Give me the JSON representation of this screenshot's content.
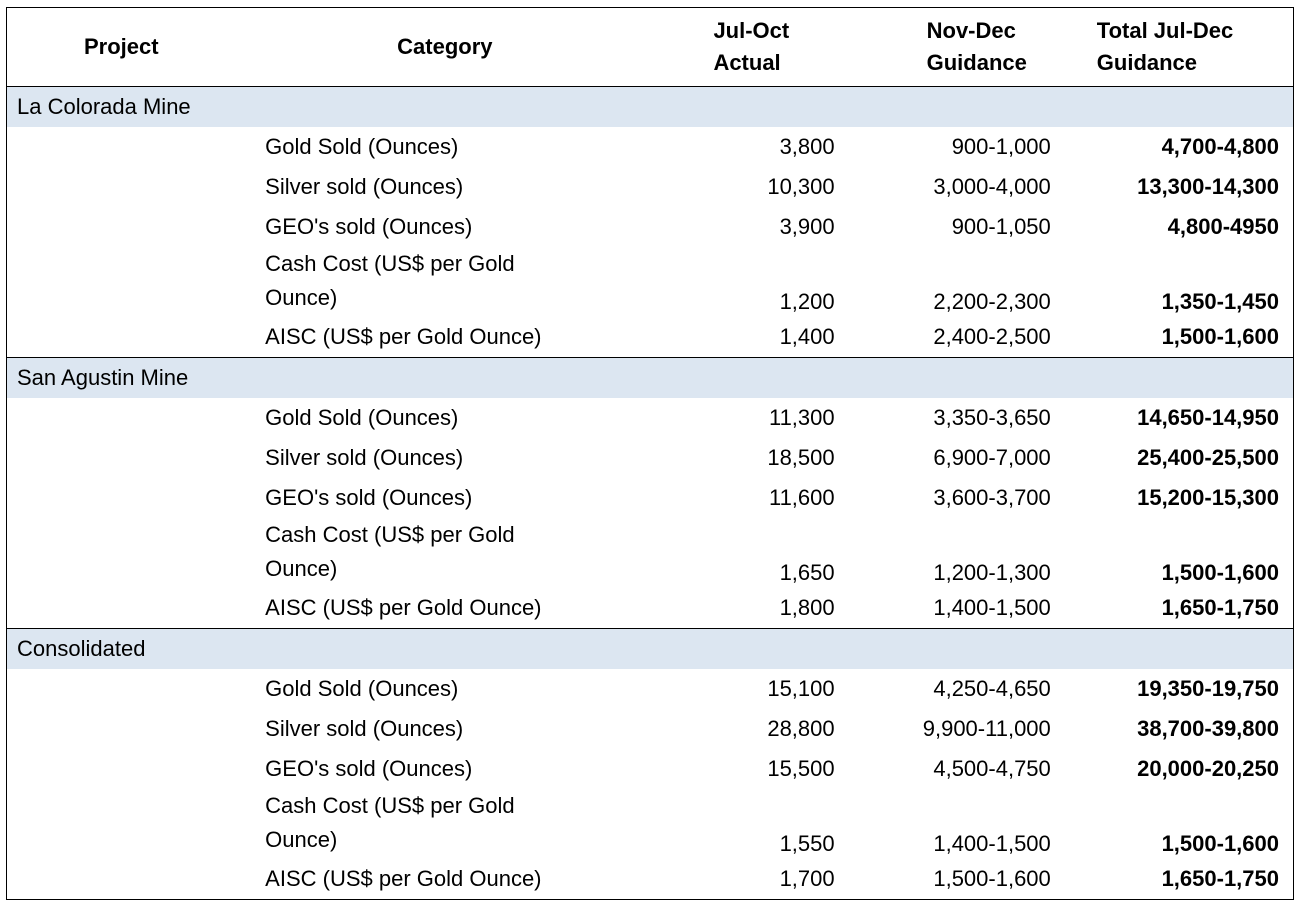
{
  "headers": {
    "project": "Project",
    "category": "Category",
    "jul_oct": [
      "Jul-Oct",
      "Actual"
    ],
    "nov_dec": [
      "Nov-Dec",
      "Guidance"
    ],
    "total": [
      "Total Jul-Dec",
      "Guidance"
    ]
  },
  "sections": [
    {
      "name": "La Colorada Mine",
      "rows": [
        {
          "category": "Gold Sold (Ounces)",
          "jul_oct": "3,800",
          "nov_dec": "900-1,000",
          "total": "4,700-4,800"
        },
        {
          "category": "Silver sold (Ounces)",
          "jul_oct": "10,300",
          "nov_dec": "3,000-4,000",
          "total": "13,300-14,300"
        },
        {
          "category": "GEO's sold (Ounces)",
          "jul_oct": "3,900",
          "nov_dec": "900-1,050",
          "total": "4,800-4950"
        },
        {
          "category": "Cash Cost (US$ per Gold\nOunce)",
          "jul_oct": "1,200",
          "nov_dec": "2,200-2,300",
          "total": "1,350-1,450"
        },
        {
          "category": "AISC (US$ per Gold Ounce)",
          "jul_oct": "1,400",
          "nov_dec": "2,400-2,500",
          "total": "1,500-1,600"
        }
      ]
    },
    {
      "name": "San Agustin Mine",
      "rows": [
        {
          "category": "Gold Sold (Ounces)",
          "jul_oct": "11,300",
          "nov_dec": "3,350-3,650",
          "total": "14,650-14,950"
        },
        {
          "category": "Silver sold (Ounces)",
          "jul_oct": "18,500",
          "nov_dec": "6,900-7,000",
          "total": "25,400-25,500"
        },
        {
          "category": "GEO's sold (Ounces)",
          "jul_oct": "11,600",
          "nov_dec": "3,600-3,700",
          "total": "15,200-15,300"
        },
        {
          "category": "Cash Cost (US$ per Gold\nOunce)",
          "jul_oct": "1,650",
          "nov_dec": "1,200-1,300",
          "total": "1,500-1,600"
        },
        {
          "category": "AISC (US$ per Gold Ounce)",
          "jul_oct": "1,800",
          "nov_dec": "1,400-1,500",
          "total": "1,650-1,750"
        }
      ]
    },
    {
      "name": "Consolidated",
      "rows": [
        {
          "category": "Gold Sold (Ounces)",
          "jul_oct": "15,100",
          "nov_dec": "4,250-4,650",
          "total": "19,350-19,750"
        },
        {
          "category": "Silver sold (Ounces)",
          "jul_oct": "28,800",
          "nov_dec": "9,900-11,000",
          "total": "38,700-39,800"
        },
        {
          "category": "GEO's sold (Ounces)",
          "jul_oct": "15,500",
          "nov_dec": "4,500-4,750",
          "total": "20,000-20,250"
        },
        {
          "category": "Cash Cost (US$ per Gold\nOunce)",
          "jul_oct": "1,550",
          "nov_dec": "1,400-1,500",
          "total": "1,500-1,600"
        },
        {
          "category": "AISC (US$ per Gold Ounce)",
          "jul_oct": "1,700",
          "nov_dec": "1,500-1,600",
          "total": "1,650-1,750"
        }
      ]
    }
  ],
  "colors": {
    "section_band": "#dce6f1",
    "border": "#000000"
  }
}
